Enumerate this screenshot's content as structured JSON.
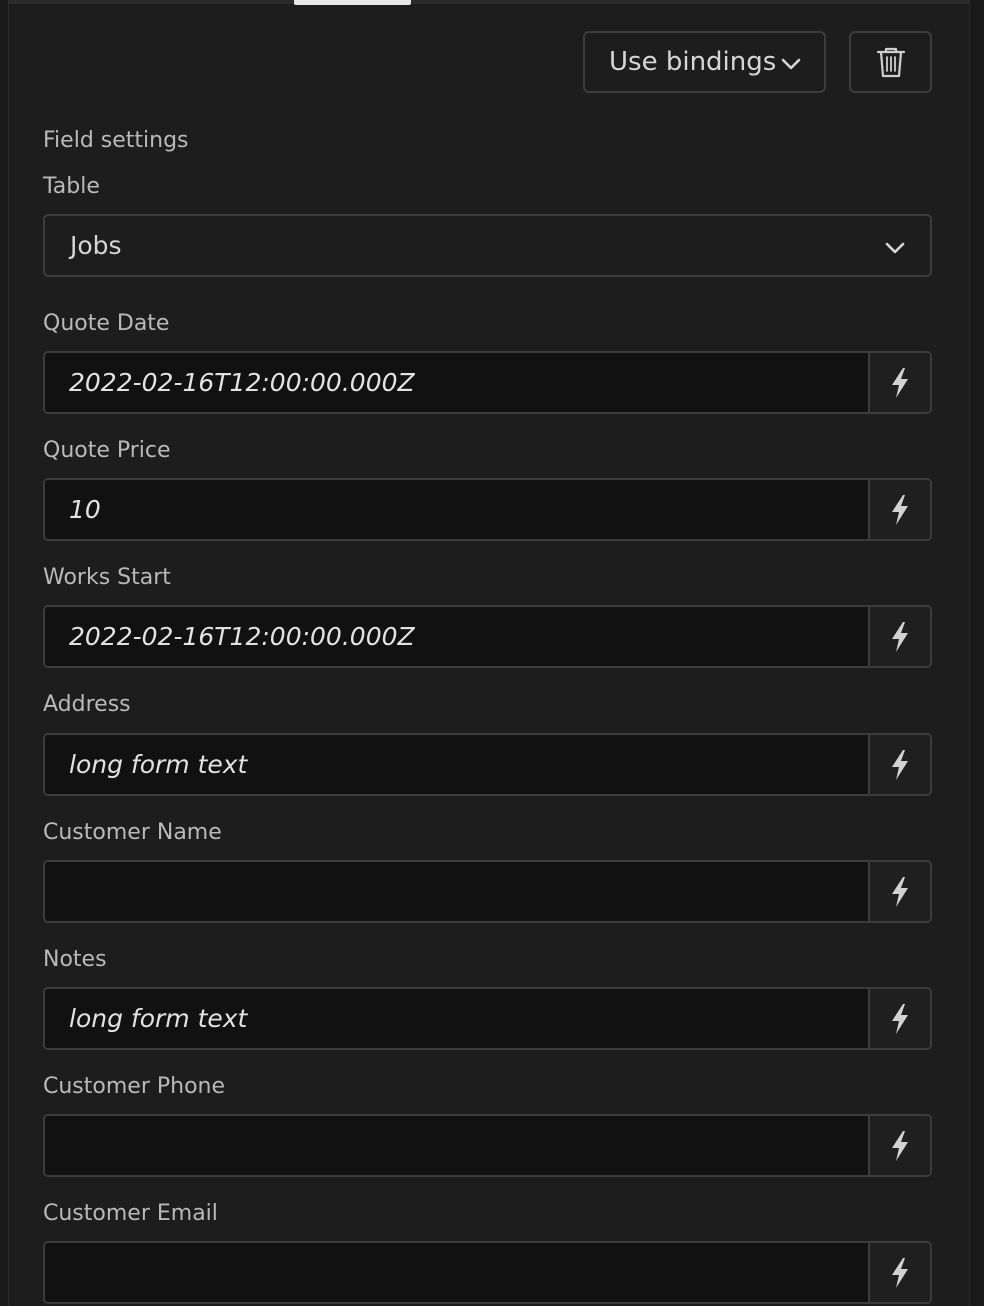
{
  "header": {
    "bindings_select": {
      "value": "Use bindings"
    }
  },
  "section": {
    "title": "Field settings"
  },
  "table": {
    "label": "Table",
    "value": "Jobs"
  },
  "fields": [
    {
      "label": "Quote Date",
      "value": "2022-02-16T12:00:00.000Z",
      "placeholder": ""
    },
    {
      "label": "Quote Price",
      "value": "10",
      "placeholder": ""
    },
    {
      "label": "Works Start",
      "value": "2022-02-16T12:00:00.000Z",
      "placeholder": ""
    },
    {
      "label": "Address",
      "value": "long form text",
      "placeholder": ""
    },
    {
      "label": "Customer Name",
      "value": "",
      "placeholder": ""
    },
    {
      "label": "Notes",
      "value": "long form text",
      "placeholder": ""
    },
    {
      "label": "Customer Phone",
      "value": "",
      "placeholder": ""
    },
    {
      "label": "Customer Email",
      "value": "",
      "placeholder": ""
    }
  ],
  "icons": {
    "bindings_chevron": "chevron-down-icon",
    "delete": "trash-icon",
    "table_chevron": "chevron-down-icon",
    "binding": "lightning-bolt-icon"
  },
  "colors": {
    "background": "#1d1d1d",
    "input_background": "#111111",
    "border": "#3c3c3c",
    "label": "#b9b9b9",
    "text": "#e2e2e2"
  }
}
